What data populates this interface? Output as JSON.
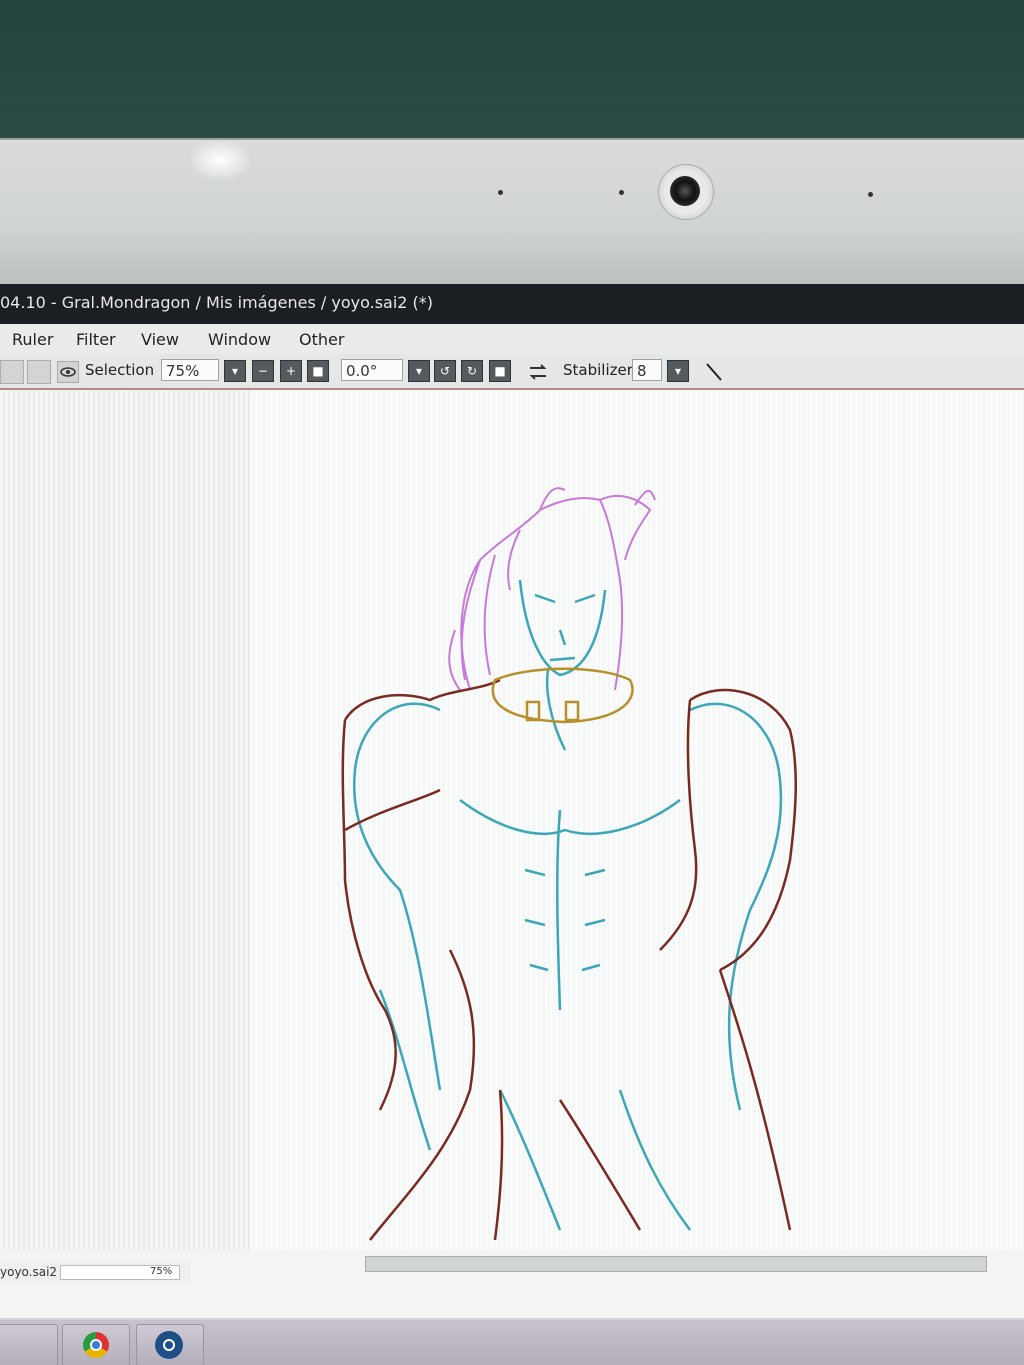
{
  "window": {
    "title": "04.10 - Gral.Mondragon / Mis imágenes /  yoyo.sai2 (*)"
  },
  "menu": {
    "items": [
      "Ruler",
      "Filter",
      "View",
      "Window",
      "Other"
    ]
  },
  "toolbar": {
    "selection_label": "Selection",
    "zoom_value": "75%",
    "rotation_value": "0.0°",
    "stabilizer_label": "Stabilizer",
    "stabilizer_value": "8"
  },
  "status": {
    "filename": "yoyo.sai2",
    "zoom": "75%"
  },
  "colors": {
    "hair_line": "#c77ad9",
    "body_line": "#3ba7b8",
    "outer_line": "#7a2a20",
    "collar_line": "#b8902a"
  },
  "taskbar": {
    "apps": [
      "blank-app-icon",
      "chrome-icon",
      "steam-icon"
    ]
  }
}
